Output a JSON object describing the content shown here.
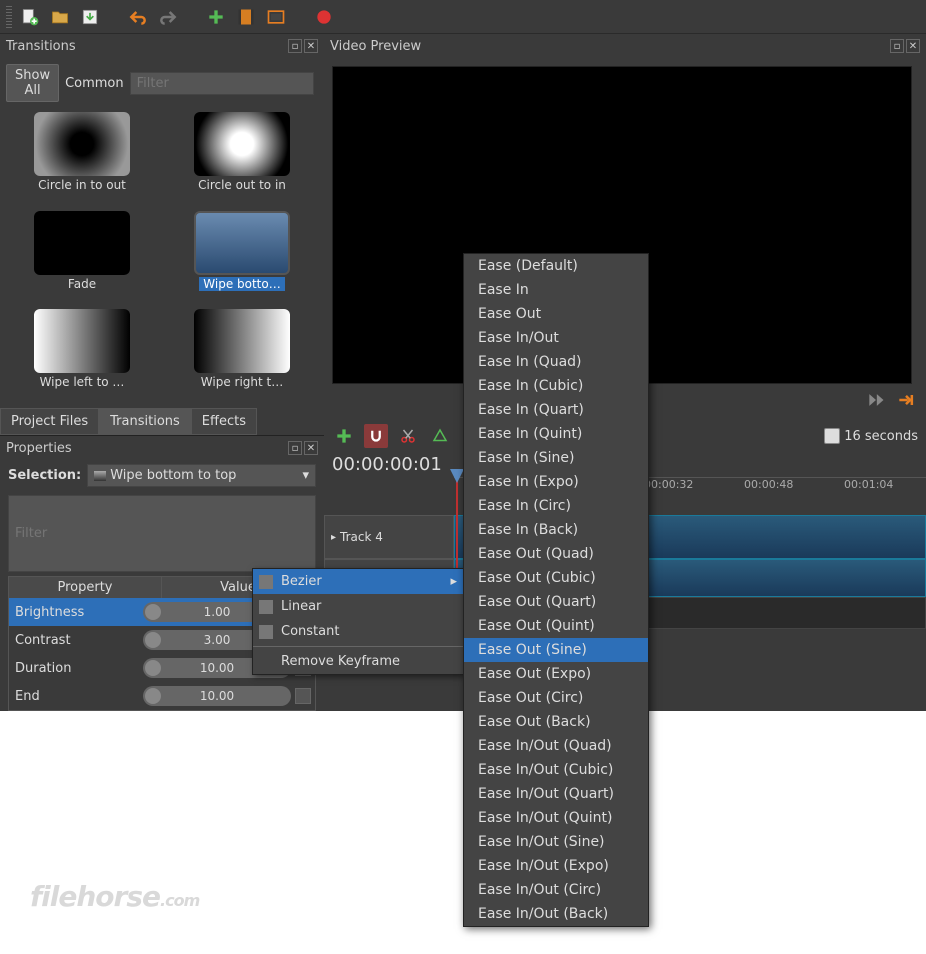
{
  "panels": {
    "transitions_title": "Transitions",
    "video_preview_title": "Video Preview",
    "properties_title": "Properties"
  },
  "trans_filter": {
    "show_all": "Show All",
    "common": "Common",
    "filter_ph": "Filter"
  },
  "transitions": [
    {
      "label": "Circle in to out",
      "cls": "circle-in"
    },
    {
      "label": "Circle out to in",
      "cls": "circle-out"
    },
    {
      "label": "Fade",
      "cls": "fade"
    },
    {
      "label": "Wipe botto…",
      "cls": "wipe-bt",
      "selected": true
    },
    {
      "label": "Wipe left to …",
      "cls": "wipe-lr"
    },
    {
      "label": "Wipe right t…",
      "cls": "wipe-rl"
    }
  ],
  "tabs": [
    {
      "label": "Project Files",
      "active": false
    },
    {
      "label": "Transitions",
      "active": true
    },
    {
      "label": "Effects",
      "active": false
    }
  ],
  "selection": {
    "label": "Selection:",
    "value": "Wipe bottom to top"
  },
  "props_filter_ph": "Filter",
  "prop_headers": {
    "property": "Property",
    "value": "Value"
  },
  "properties": [
    {
      "name": "Brightness",
      "value": "1.00",
      "selected": true
    },
    {
      "name": "Contrast",
      "value": "3.00"
    },
    {
      "name": "Duration",
      "value": "10.00"
    },
    {
      "name": "End",
      "value": "10.00"
    }
  ],
  "ctx_menu": [
    {
      "label": "Bezier",
      "selected": true,
      "submenu": true,
      "icon": true
    },
    {
      "label": "Linear",
      "icon": true
    },
    {
      "label": "Constant",
      "icon": true
    },
    {
      "sep": true
    },
    {
      "label": "Remove Keyframe"
    }
  ],
  "easing": [
    "Ease (Default)",
    "Ease In",
    "Ease Out",
    "Ease In/Out",
    "Ease In (Quad)",
    "Ease In (Cubic)",
    "Ease In (Quart)",
    "Ease In (Quint)",
    "Ease In (Sine)",
    "Ease In (Expo)",
    "Ease In (Circ)",
    "Ease In (Back)",
    "Ease Out (Quad)",
    "Ease Out (Cubic)",
    "Ease Out (Quart)",
    "Ease Out (Quint)",
    "Ease Out (Sine)",
    "Ease Out (Expo)",
    "Ease Out (Circ)",
    "Ease Out (Back)",
    "Ease In/Out (Quad)",
    "Ease In/Out (Cubic)",
    "Ease In/Out (Quart)",
    "Ease In/Out (Quint)",
    "Ease In/Out (Sine)",
    "Ease In/Out (Expo)",
    "Ease In/Out (Circ)",
    "Ease In/Out (Back)"
  ],
  "easing_selected_index": 16,
  "timeline": {
    "timecode": "00:00:00:01",
    "snap_label": "16 seconds",
    "track_name": "Track 4",
    "ruler": [
      "00:00:32",
      "00:00:48",
      "00:01:04"
    ]
  },
  "watermark": {
    "name": "filehorse",
    "suffix": ".com"
  }
}
